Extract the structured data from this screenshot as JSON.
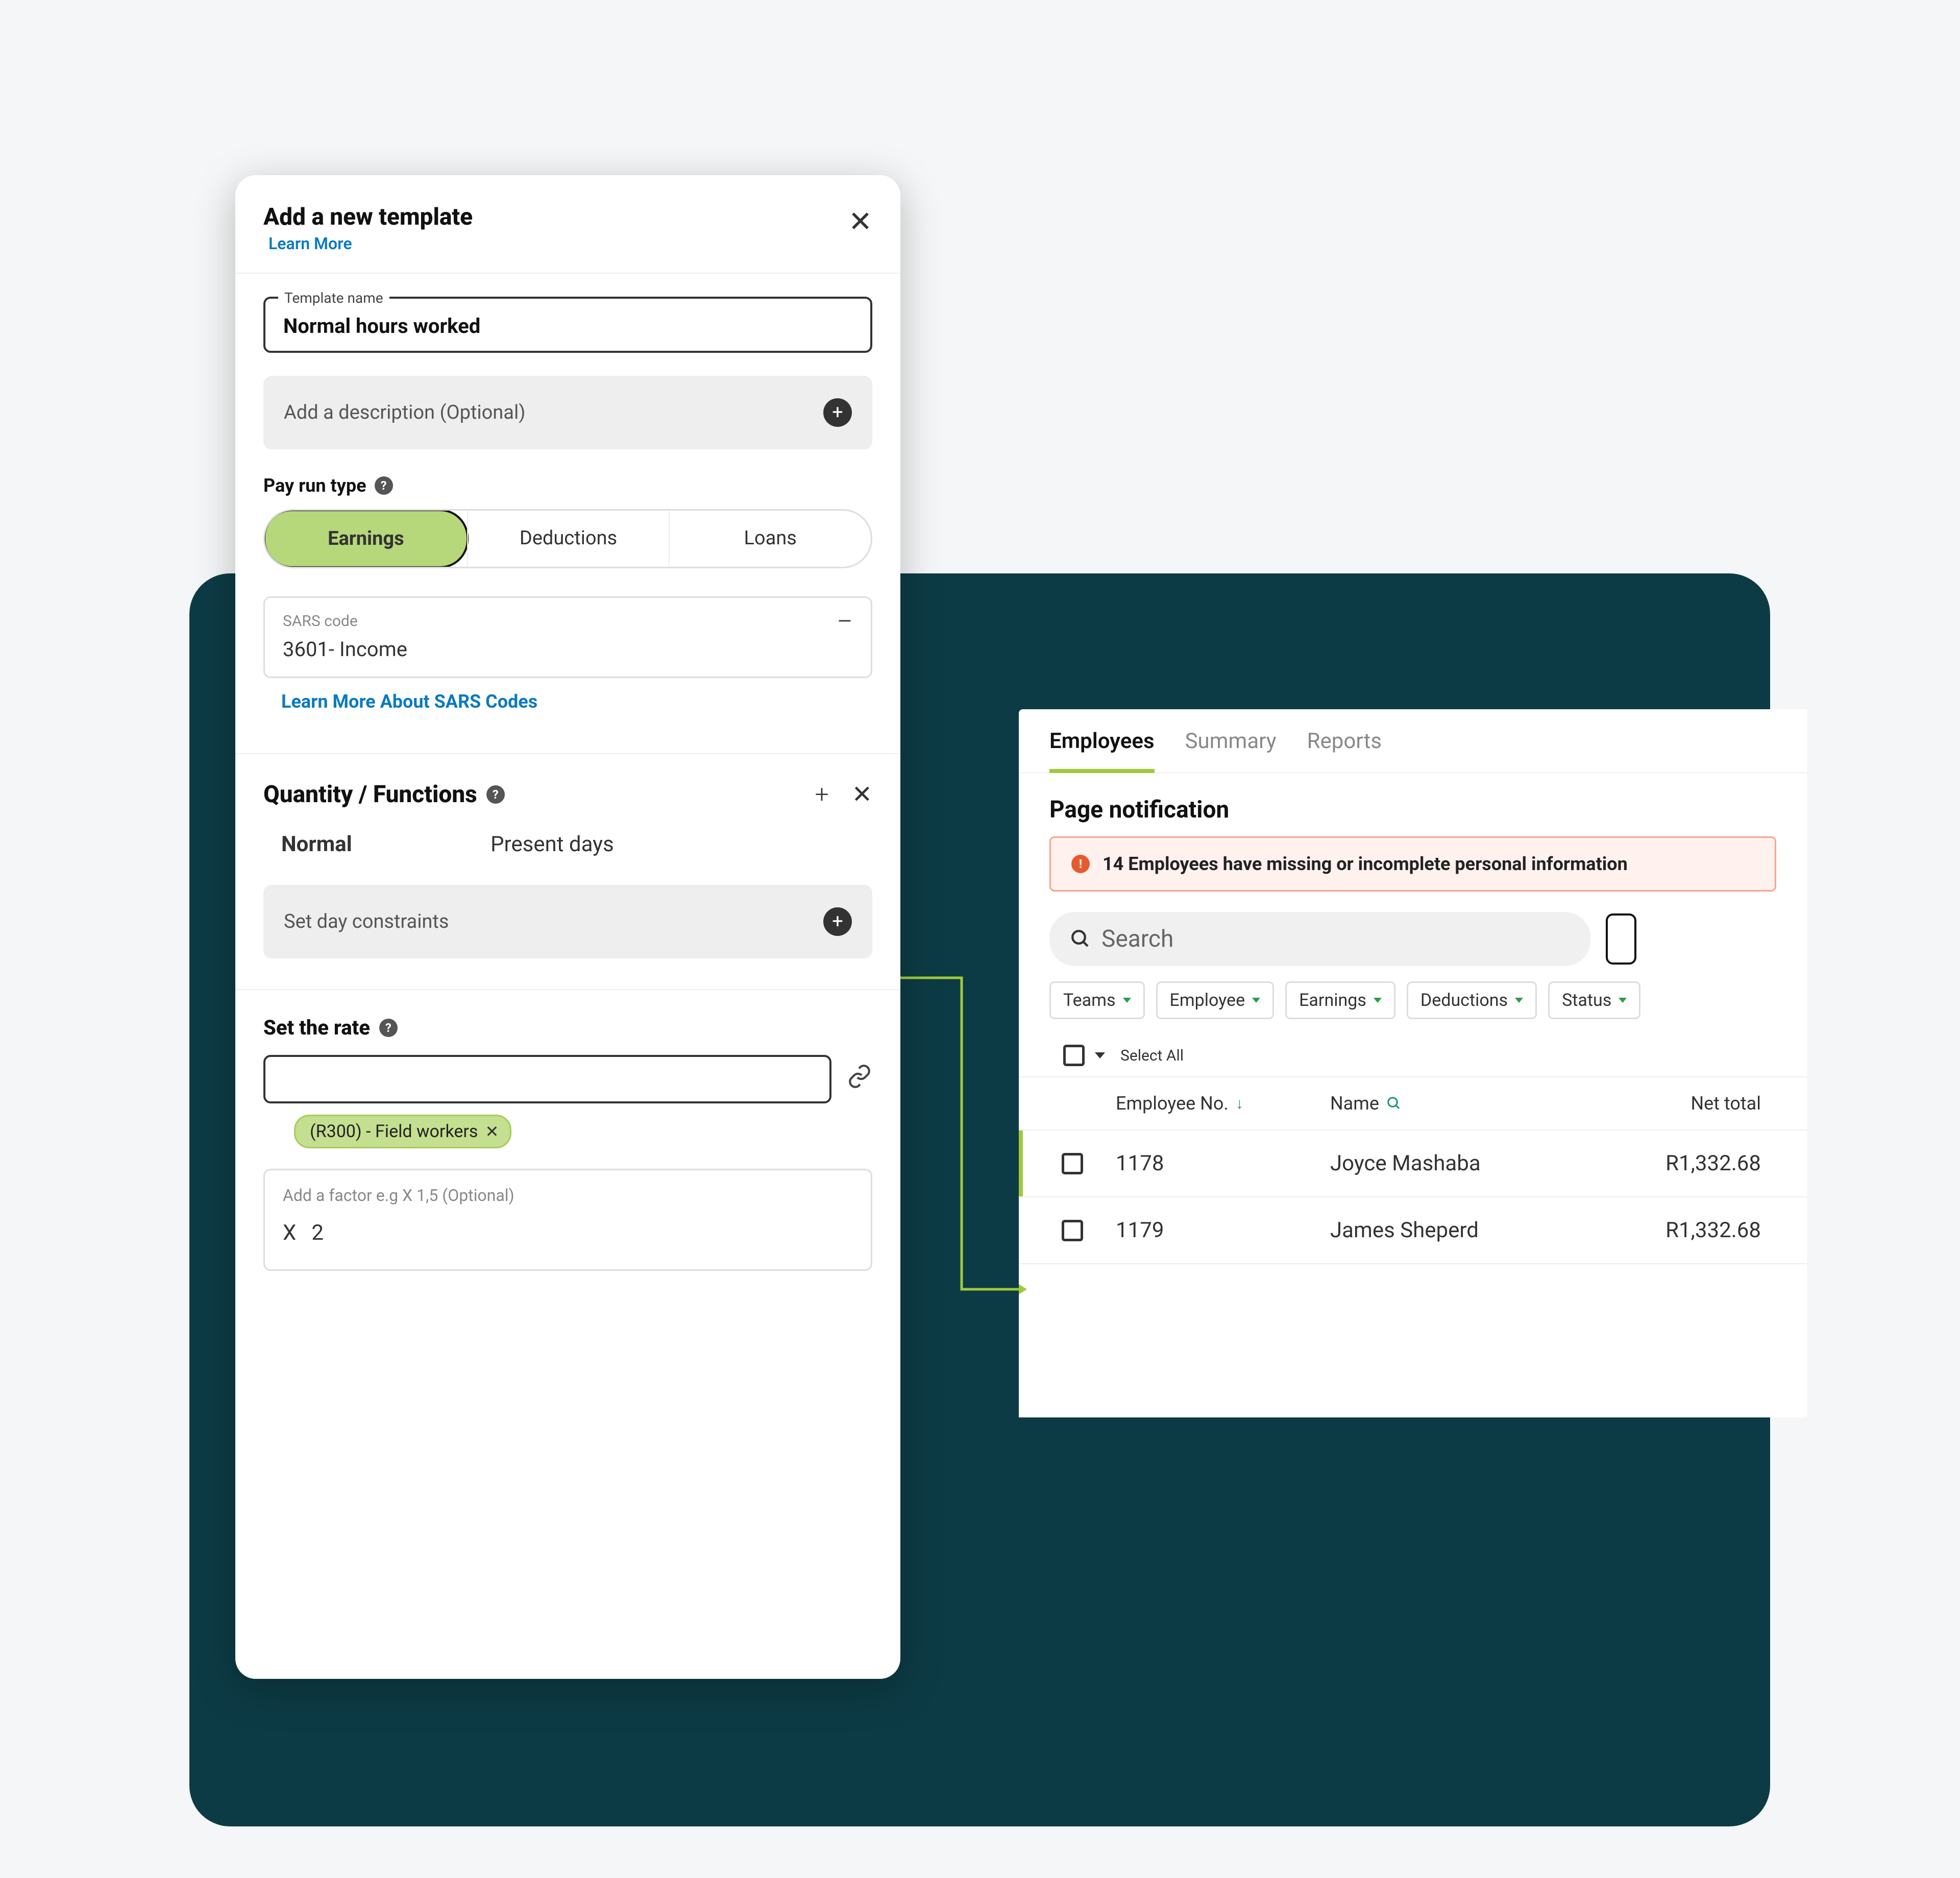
{
  "colors": {
    "accent_green": "#9fcb3b",
    "dark_panel": "#0d3b45",
    "link_blue": "#0a7abf",
    "notif_bg": "#fff1ed",
    "notif_border": "#f7a58a",
    "chip_green": "#c4df8f"
  },
  "modal": {
    "title": "Add a new template",
    "learn_more": "Learn More",
    "template_name_label": "Template name",
    "template_name_value": "Normal hours worked",
    "description_placeholder": "Add a description (Optional)",
    "pay_run_type_label": "Pay run type",
    "segments": {
      "earnings": "Earnings",
      "deductions": "Deductions",
      "loans": "Loans"
    },
    "sars": {
      "label": "SARS code",
      "value": "3601- Income",
      "link": "Learn More About SARS Codes"
    },
    "quantity_functions": {
      "title": "Quantity / Functions",
      "normal_label": "Normal",
      "present_days_label": "Present days",
      "constraints_label": "Set day constraints"
    },
    "rate": {
      "title": "Set the rate",
      "chip_text": "(R300) - Field workers",
      "factor_label": "Add a factor e.g X 1,5 (Optional)",
      "factor_x": "X",
      "factor_value": "2"
    }
  },
  "employees": {
    "tabs": {
      "employees": "Employees",
      "summary": "Summary",
      "reports": "Reports"
    },
    "section_title": "Page notification",
    "notification_text": "14 Employees have missing or incomplete personal information",
    "search_placeholder": "Search",
    "filters": [
      "Teams",
      "Employee",
      "Earnings",
      "Deductions",
      "Status"
    ],
    "select_all": "Select All",
    "columns": {
      "emp_no": "Employee No.",
      "name": "Name",
      "net_total": "Net total"
    },
    "rows": [
      {
        "no": "1178",
        "name": "Joyce Mashaba",
        "net": "R1,332.68"
      },
      {
        "no": "1179",
        "name": "James Sheperd",
        "net": "R1,332.68"
      }
    ]
  }
}
